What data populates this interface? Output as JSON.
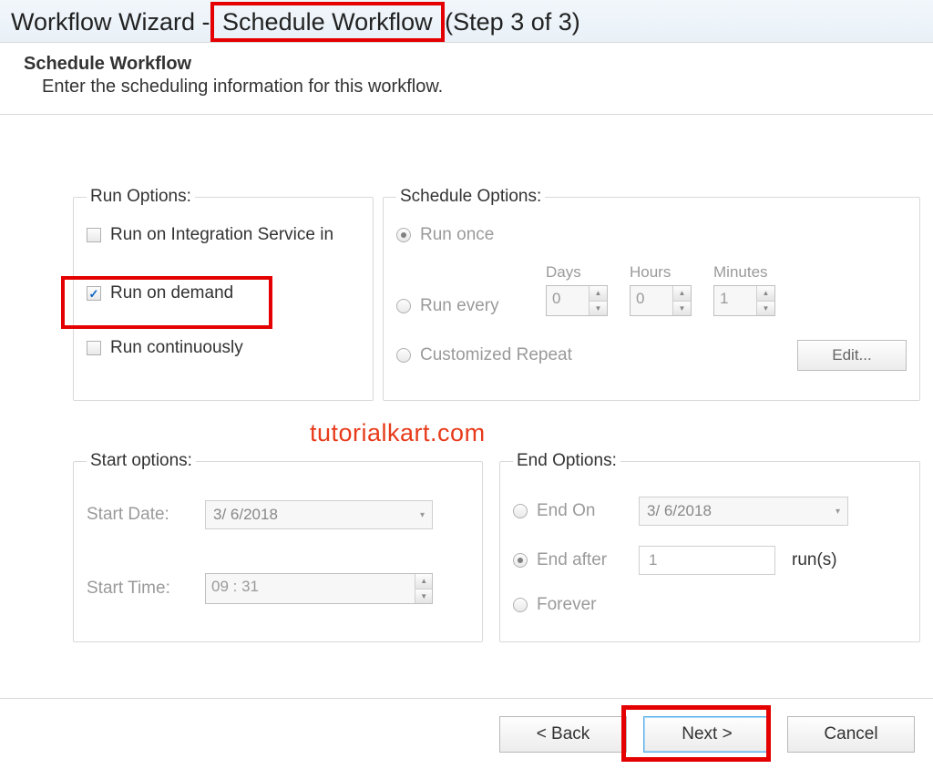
{
  "title": {
    "prefix": "Workflow Wizard -",
    "highlight": " Schedule Workflow ",
    "suffix": "(Step 3 of 3)"
  },
  "header": {
    "title": "Schedule Workflow",
    "desc": "Enter the scheduling information for this workflow."
  },
  "run": {
    "legend": "Run Options:",
    "integration": "Run on Integration Service in",
    "demand": "Run on demand",
    "continuous": "Run continuously"
  },
  "schedule": {
    "legend": "Schedule Options:",
    "once": "Run once",
    "every": "Run every",
    "days_label": "Days",
    "hours_label": "Hours",
    "minutes_label": "Minutes",
    "days": "0",
    "hours": "0",
    "minutes": "1",
    "custom": "Customized Repeat",
    "edit": "Edit..."
  },
  "start": {
    "legend": "Start options:",
    "date_label": "Start Date:",
    "date": "3/ 6/2018",
    "time_label": "Start Time:",
    "time": "09 : 31"
  },
  "end": {
    "legend": "End Options:",
    "on": "End On",
    "on_date": "3/ 6/2018",
    "after": "End after",
    "after_val": "1",
    "runs": "run(s)",
    "forever": "Forever"
  },
  "footer": {
    "back": "< Back",
    "next": "Next >",
    "cancel": "Cancel"
  },
  "watermark": "tutorialkart.com"
}
